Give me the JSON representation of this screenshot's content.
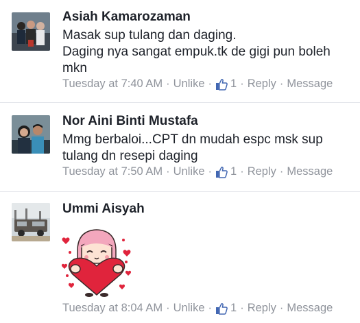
{
  "comments": [
    {
      "name": "Asiah Kamarozaman",
      "lines": [
        "Masak sup tulang dan daging.",
        "Daging nya sangat empuk.tk de gigi pun boleh",
        "mkn"
      ],
      "time": "Tuesday at 7:40 AM",
      "unlike": "Unlike",
      "likes": "1",
      "reply": "Reply",
      "message": "Message"
    },
    {
      "name": "Nor Aini Binti Mustafa",
      "lines": [
        "Mmg berbaloi...CPT dn mudah espc msk sup",
        "tulang dn resepi daging"
      ],
      "time": "Tuesday at 7:50 AM",
      "unlike": "Unlike",
      "likes": "1",
      "reply": "Reply",
      "message": "Message"
    },
    {
      "name": "Ummi Aisyah",
      "lines": [],
      "time": "Tuesday at 8:04 AM",
      "unlike": "Unlike",
      "likes": "1",
      "reply": "Reply",
      "message": "Message"
    }
  ],
  "separator": "·",
  "colors": {
    "meta": "#90949c",
    "like_blue": "#4267b2",
    "name": "#1d2129",
    "heart": "#e0243c"
  },
  "icons": {
    "like": "thumbs-up-icon",
    "sticker": "girl-holding-heart-sticker"
  }
}
